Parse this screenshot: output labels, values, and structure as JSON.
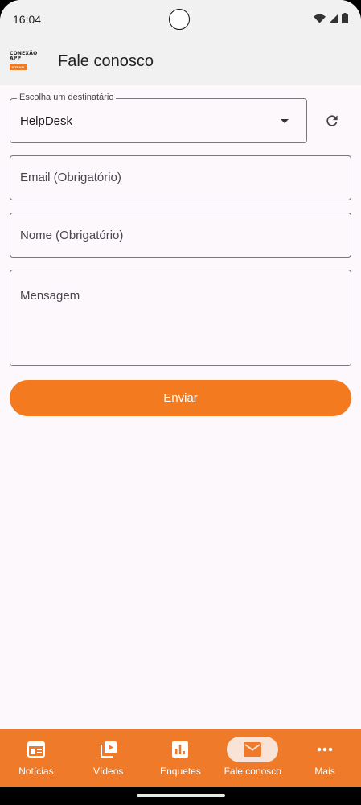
{
  "status_bar": {
    "time": "16:04"
  },
  "app_bar": {
    "title": "Fale conosco",
    "logo": {
      "line1": "CONEXÃO",
      "line2": "APP",
      "badge": "SITRAEL"
    }
  },
  "form": {
    "recipient": {
      "label": "Escolha um destinatário",
      "value": "HelpDesk"
    },
    "email": {
      "placeholder": "Email (Obrigatório)"
    },
    "name": {
      "placeholder": "Nome (Obrigatório)"
    },
    "message": {
      "placeholder": "Mensagem"
    },
    "send_label": "Enviar"
  },
  "bottom_nav": {
    "items": [
      {
        "label": "Notícias",
        "icon": "newspaper-icon"
      },
      {
        "label": "Vídeos",
        "icon": "video-library-icon"
      },
      {
        "label": "Enquetes",
        "icon": "poll-icon"
      },
      {
        "label": "Fale conosco",
        "icon": "mail-icon",
        "active": true
      },
      {
        "label": "Mais",
        "icon": "more-horizontal-icon"
      }
    ]
  },
  "colors": {
    "accent": "#f47a20",
    "nav_background": "#ef7b2a",
    "active_pill": "#f9e3d6",
    "surface": "#fcf8fb"
  }
}
